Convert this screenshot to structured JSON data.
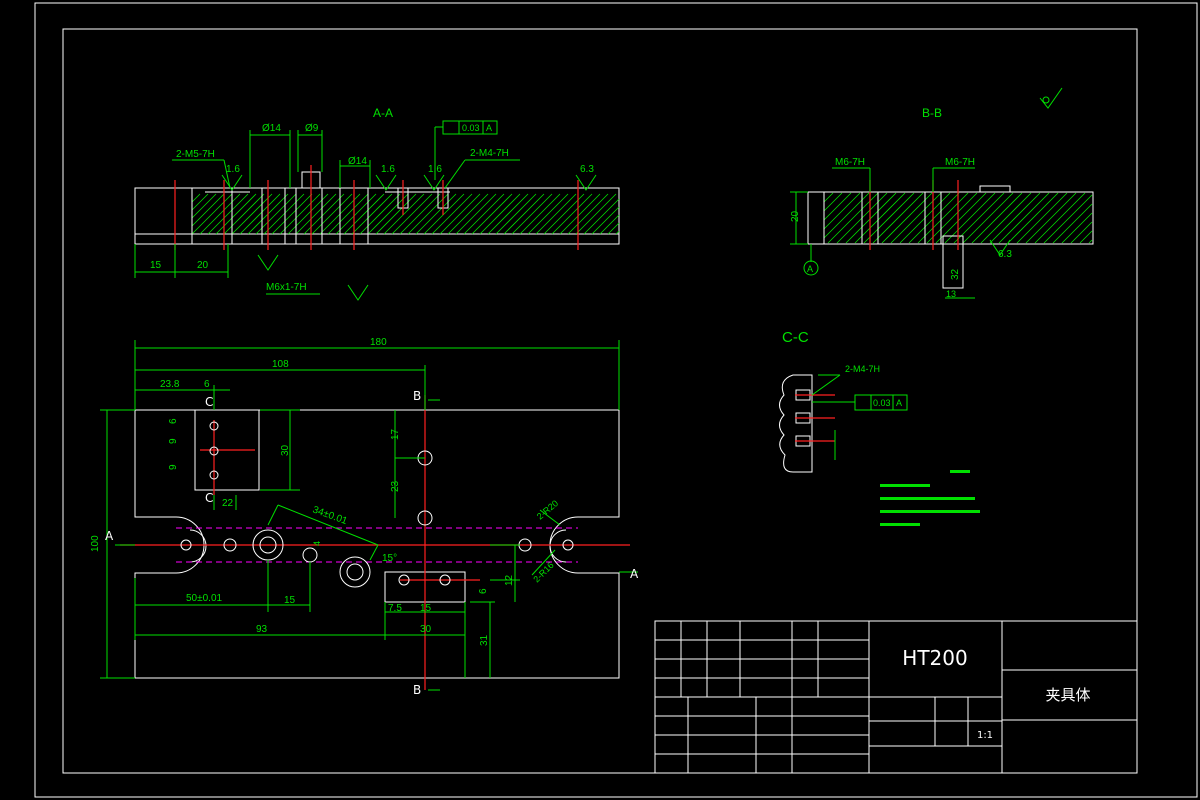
{
  "sections": {
    "aa": "A-A",
    "bb": "B-B",
    "cc": "C-C",
    "b_top": "B",
    "b_bottom": "B",
    "a_left": "A",
    "a_right": "A",
    "c_top": "C",
    "c_bottom": "C"
  },
  "title_block": {
    "material": "HT200",
    "part_name": "夹具体",
    "scale": "1:1"
  },
  "dims_plan": {
    "d180": "180",
    "d108": "108",
    "d238": "23.8",
    "d6": "6",
    "d6b": "6",
    "d9a": "9",
    "d9b": "9",
    "d30": "30",
    "d22": "22",
    "d17": "17",
    "d23": "23",
    "d100": "100",
    "d34": "34±0.01",
    "d50": "50±0.01",
    "d15": "15",
    "d93": "93",
    "d75": "7.5",
    "d15b": "15",
    "d30b": "30",
    "d12": "12",
    "d6c": "6",
    "d31": "31",
    "d4": "4",
    "d15deg": "15°",
    "r20": "2-R20",
    "r16": "2-R16"
  },
  "dims_aa": {
    "m5": "2-M5-7H",
    "m4": "2-M4-7H",
    "d14a": "Ø14",
    "d9": "Ø9",
    "d14b": "Ø14",
    "m6": "M6x1-7H",
    "s16a": "1.6",
    "s16b": "1.6",
    "s16c": "1.6",
    "s63": "6.3",
    "tol": "0.03",
    "datum": "A",
    "d15": "15",
    "d20": "20"
  },
  "dims_bb": {
    "m6a": "M6-7H",
    "m6b": "M6-7H",
    "d20": "20",
    "d32": "32",
    "d13": "13",
    "s63": "6.3",
    "datum": "A"
  },
  "dims_cc": {
    "m4": "2-M4-7H",
    "tol": "0.03",
    "datum": "A"
  }
}
